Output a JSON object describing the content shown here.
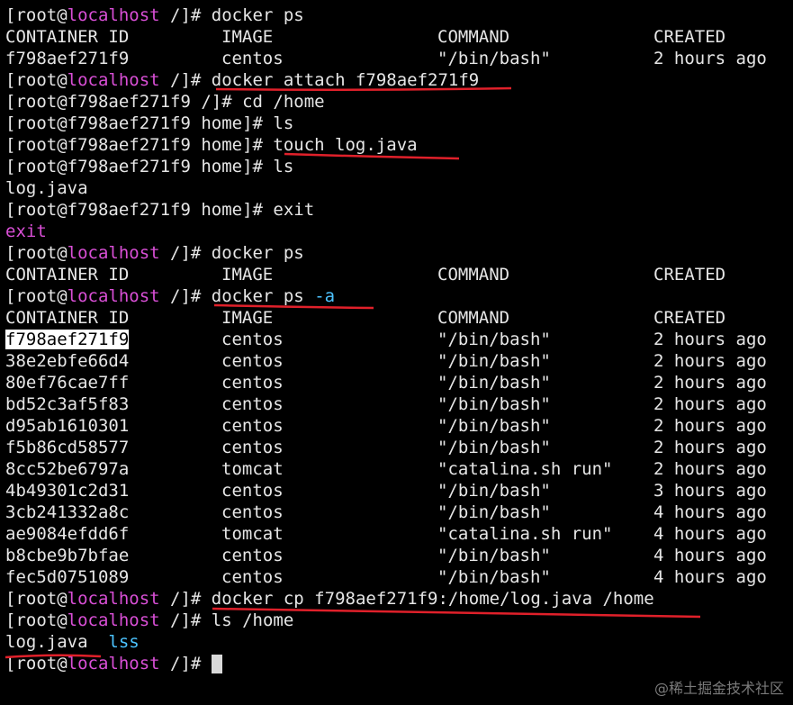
{
  "colors": {
    "background": "#000000",
    "text": "#e6e6e6",
    "host": "#d94fd6",
    "flag": "#4cc3ff",
    "underline": "#e0202a"
  },
  "prompt": {
    "user": "[root@",
    "host": "localhost",
    "root_dir": " /]# ",
    "container_prefix": "[root@f798aef271f9"
  },
  "headers": [
    "CONTAINER ID",
    "IMAGE",
    "COMMAND",
    "CREATED"
  ],
  "lines": {
    "l1_cmd": "docker ps",
    "row0": [
      "f798aef271f9",
      "centos",
      "\"/bin/bash\"",
      "2 hours ago"
    ],
    "l4_cmd": "docker attach f798aef271f9",
    "l5": "[root@f798aef271f9 /]# cd /home",
    "l6": "[root@f798aef271f9 home]# ls",
    "l7_prompt": "[root@f798aef271f9 home]# ",
    "l7_cmd": "touch log.java",
    "l8": "[root@f798aef271f9 home]# ls",
    "l9": "log.java",
    "l10": "[root@f798aef271f9 home]# exit",
    "l11": "exit",
    "l12_cmd": "docker ps",
    "l14_cmd": "docker ps",
    "l14_flag": " -a",
    "l29_cmd": "docker cp f798aef271f9:/home/log.java /home",
    "l30_cmd": "ls /home",
    "l31_file": "log.java",
    "l31_dir": "lss"
  },
  "containers": [
    [
      "f798aef271f9",
      "centos",
      "\"/bin/bash\"",
      "2 hours ago"
    ],
    [
      "38e2ebfe66d4",
      "centos",
      "\"/bin/bash\"",
      "2 hours ago"
    ],
    [
      "80ef76cae7ff",
      "centos",
      "\"/bin/bash\"",
      "2 hours ago"
    ],
    [
      "bd52c3af5f83",
      "centos",
      "\"/bin/bash\"",
      "2 hours ago"
    ],
    [
      "d95ab1610301",
      "centos",
      "\"/bin/bash\"",
      "2 hours ago"
    ],
    [
      "f5b86cd58577",
      "centos",
      "\"/bin/bash\"",
      "2 hours ago"
    ],
    [
      "8cc52be6797a",
      "tomcat",
      "\"catalina.sh run\"",
      "2 hours ago"
    ],
    [
      "4b49301c2d31",
      "centos",
      "\"/bin/bash\"",
      "3 hours ago"
    ],
    [
      "3cb241332a8c",
      "centos",
      "\"/bin/bash\"",
      "4 hours ago"
    ],
    [
      "ae9084efdd6f",
      "tomcat",
      "\"catalina.sh run\"",
      "4 hours ago"
    ],
    [
      "b8cbe9b7bfae",
      "centos",
      "\"/bin/bash\"",
      "4 hours ago"
    ],
    [
      "fec5d0751089",
      "centos",
      "\"/bin/bash\"",
      "4 hours ago"
    ]
  ],
  "watermark": "@稀土掘金技术社区"
}
